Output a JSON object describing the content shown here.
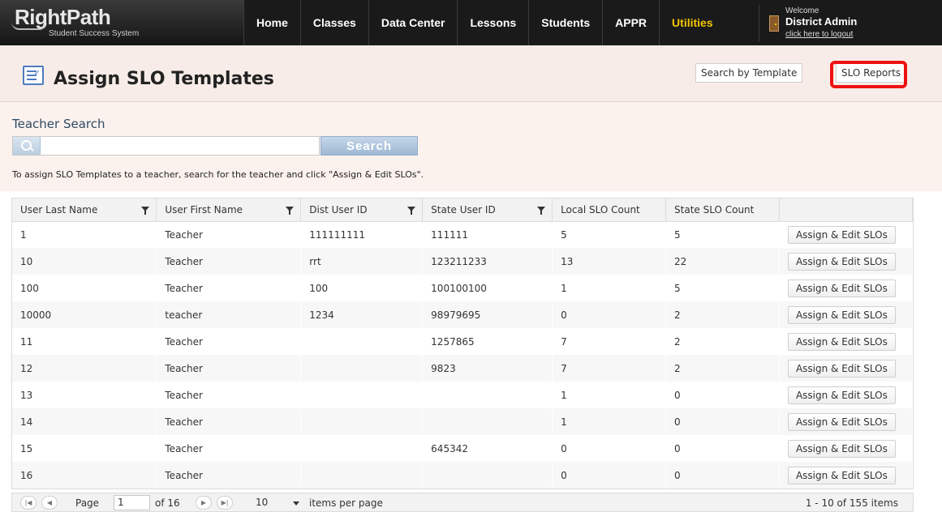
{
  "app": {
    "brand": "RightPath",
    "tagline": "Student Success System"
  },
  "nav": {
    "items": [
      {
        "label": "Home",
        "active": false
      },
      {
        "label": "Classes",
        "active": false
      },
      {
        "label": "Data Center",
        "active": false
      },
      {
        "label": "Lessons",
        "active": false
      },
      {
        "label": "Students",
        "active": false
      },
      {
        "label": "APPR",
        "active": false
      },
      {
        "label": "Utilities",
        "active": true
      }
    ],
    "active_color": "#f3c500"
  },
  "user": {
    "welcome": "Welcome",
    "name": "District Admin",
    "logout": "click here to logout"
  },
  "page": {
    "title": "Assign SLO Templates",
    "search_by_template_label": "Search by Template",
    "slo_reports_label": "SLO Reports",
    "highlight_color": "#ee1111"
  },
  "search": {
    "section_title": "Teacher Search",
    "value": "",
    "placeholder": "",
    "button_label": "Search",
    "instructions": "To assign SLO Templates to a teacher, search for the teacher and click \"Assign & Edit SLOs\"."
  },
  "grid": {
    "columns": [
      {
        "label": "User Last Name",
        "filter": true
      },
      {
        "label": "User First Name",
        "filter": true
      },
      {
        "label": "Dist User ID",
        "filter": true
      },
      {
        "label": "State User ID",
        "filter": true
      },
      {
        "label": "Local SLO Count",
        "filter": false
      },
      {
        "label": "State SLO Count",
        "filter": false
      },
      {
        "label": "",
        "filter": false
      }
    ],
    "action_label": "Assign & Edit SLOs",
    "rows": [
      {
        "last": "1",
        "first": "Teacher",
        "dist_id": "111111111",
        "state_id": "111111",
        "local": "5",
        "state": "5"
      },
      {
        "last": "10",
        "first": "Teacher",
        "dist_id": "rrt",
        "state_id": "123211233",
        "local": "13",
        "state": "22"
      },
      {
        "last": "100",
        "first": "Teacher",
        "dist_id": "100",
        "state_id": "100100100",
        "local": "1",
        "state": "5"
      },
      {
        "last": "10000",
        "first": "teacher",
        "dist_id": "1234",
        "state_id": "98979695",
        "local": "0",
        "state": "2"
      },
      {
        "last": "11",
        "first": "Teacher",
        "dist_id": "",
        "state_id": "1257865",
        "local": "7",
        "state": "2"
      },
      {
        "last": "12",
        "first": "Teacher",
        "dist_id": "",
        "state_id": "9823",
        "local": "7",
        "state": "2"
      },
      {
        "last": "13",
        "first": "Teacher",
        "dist_id": "",
        "state_id": "",
        "local": "1",
        "state": "0"
      },
      {
        "last": "14",
        "first": "Teacher",
        "dist_id": "",
        "state_id": "",
        "local": "1",
        "state": "0"
      },
      {
        "last": "15",
        "first": "Teacher",
        "dist_id": "",
        "state_id": "645342",
        "local": "0",
        "state": "0"
      },
      {
        "last": "16",
        "first": "Teacher",
        "dist_id": "",
        "state_id": "",
        "local": "0",
        "state": "0"
      }
    ]
  },
  "pager": {
    "page_label": "Page",
    "page_value": "1",
    "of_label": "of 16",
    "page_size": "10",
    "items_per_page_label": "items per page",
    "summary": "1 - 10 of 155 items"
  }
}
